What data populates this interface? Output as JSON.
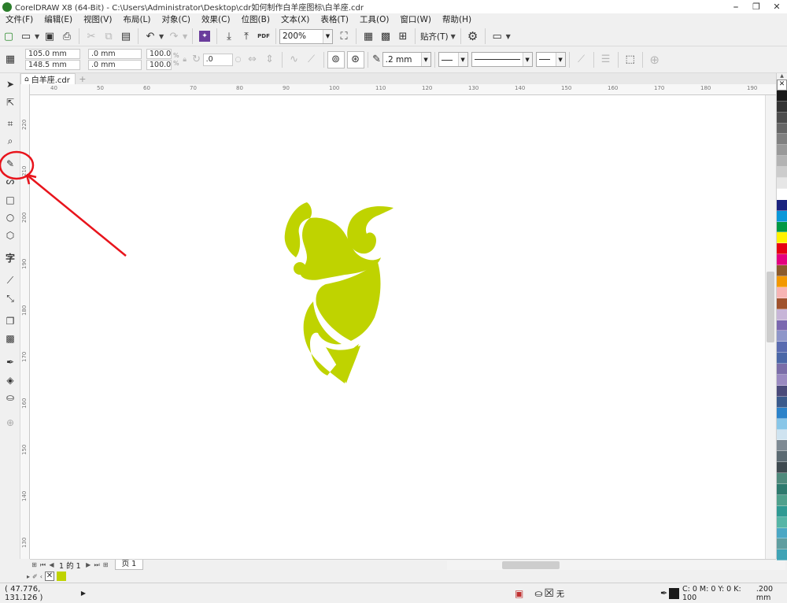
{
  "window": {
    "title": "CorelDRAW X8 (64-Bit) - C:\\Users\\Administrator\\Desktop\\cdr如何制作白羊座图标\\白羊座.cdr",
    "controls": [
      "⎯",
      "❐",
      "✕"
    ]
  },
  "menu": [
    "文件(F)",
    "编辑(E)",
    "视图(V)",
    "布局(L)",
    "对象(C)",
    "效果(C)",
    "位图(B)",
    "文本(X)",
    "表格(T)",
    "工具(O)",
    "窗口(W)",
    "帮助(H)"
  ],
  "standard_toolbar": {
    "pdf_label": "PDF",
    "zoom_value": "200%",
    "snap_label": "贴齐(T)"
  },
  "property_bar": {
    "x": "105.0 mm",
    "y": "148.5 mm",
    "width": ".0 mm",
    "height": ".0 mm",
    "scale_x": "100.0",
    "scale_y": "100.0",
    "percent": "%",
    "rotation": ".0",
    "outline_width": ".2 mm"
  },
  "document_tab": {
    "label": "白羊座.cdr"
  },
  "ruler": {
    "h_ticks": [
      "40",
      "50",
      "60",
      "70",
      "80",
      "90",
      "100",
      "110",
      "120",
      "130",
      "140",
      "150",
      "160",
      "170",
      "180",
      "190"
    ],
    "v_ticks": [
      "220",
      "210",
      "200",
      "190",
      "180",
      "170",
      "160",
      "150",
      "140",
      "130"
    ],
    "unit": "毫米"
  },
  "page_nav": {
    "counter": "1 的 1",
    "page_tab": "页 1"
  },
  "status": {
    "coordinates": "( 47.776, 131.126 )",
    "fill_none": "无",
    "outline_color": "C: 0 M: 0 Y: 0 K: 100",
    "outline_width": ".200 mm"
  },
  "colors": {
    "ram_logo": "#bfd300",
    "annotation": "#e8141c",
    "outline_swatch": "#1a1a1a"
  },
  "palette": [
    "#ffffff",
    "#1a1a1a",
    "#333333",
    "#4d4d4d",
    "#666666",
    "#808080",
    "#999999",
    "#b3b3b3",
    "#cccccc",
    "#e6e6e6",
    "#ffffff",
    "#1a237e",
    "#0a97d9",
    "#009944",
    "#fff200",
    "#e60012",
    "#e4007f",
    "#8b5a2b",
    "#f39800",
    "#f7b4b4",
    "#a0522d",
    "#c7b5d8",
    "#7b68b0",
    "#8e95c9",
    "#596bb0",
    "#4b67a7",
    "#7a6da8",
    "#9a8ac1",
    "#4a4a7a",
    "#3a5a8c",
    "#2c82c9",
    "#88c6e8",
    "#cfe3f0",
    "#7e8a93",
    "#5b6a72",
    "#3e4a50",
    "#4f8a7c",
    "#2e7a6e",
    "#4fa08c",
    "#2f9a93",
    "#55b5a6",
    "#4aa7c4",
    "#5f9ea0",
    "#3fa3b5"
  ]
}
